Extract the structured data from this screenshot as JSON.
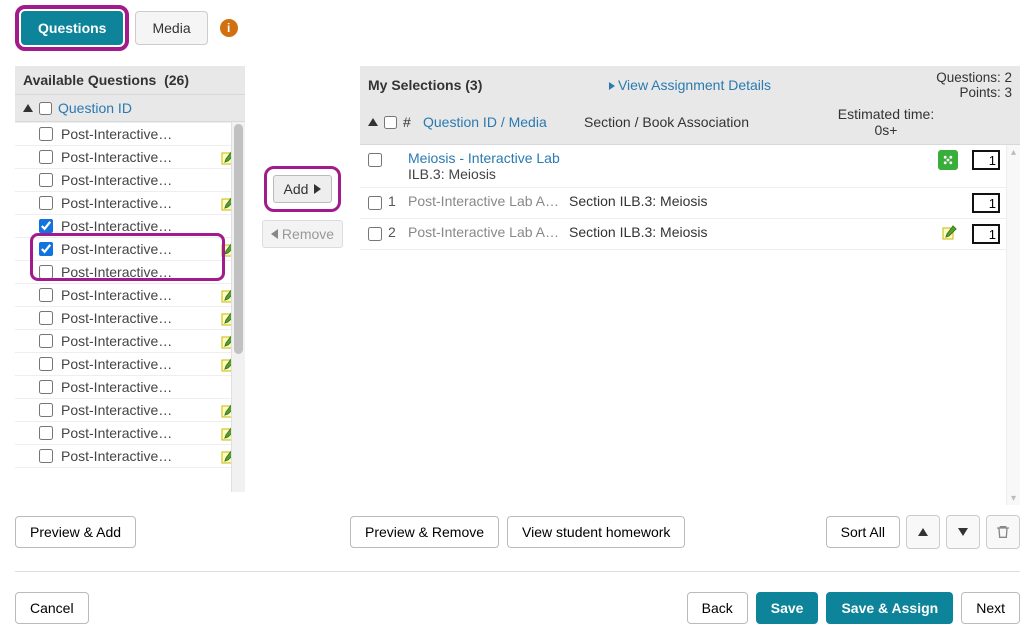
{
  "tabs": {
    "questions": "Questions",
    "media": "Media"
  },
  "left": {
    "title": "Available Questions",
    "count": "(26)",
    "sort_col": "Question ID",
    "items": [
      {
        "label": "Post-Interactive…",
        "checked": false,
        "edit": false
      },
      {
        "label": "Post-Interactive…",
        "checked": false,
        "edit": true
      },
      {
        "label": "Post-Interactive…",
        "checked": false,
        "edit": false
      },
      {
        "label": "Post-Interactive…",
        "checked": false,
        "edit": true
      },
      {
        "label": "Post-Interactive…",
        "checked": true,
        "edit": false
      },
      {
        "label": "Post-Interactive…",
        "checked": true,
        "edit": true
      },
      {
        "label": "Post-Interactive…",
        "checked": false,
        "edit": false
      },
      {
        "label": "Post-Interactive…",
        "checked": false,
        "edit": true
      },
      {
        "label": "Post-Interactive…",
        "checked": false,
        "edit": true
      },
      {
        "label": "Post-Interactive…",
        "checked": false,
        "edit": true
      },
      {
        "label": "Post-Interactive…",
        "checked": false,
        "edit": true
      },
      {
        "label": "Post-Interactive…",
        "checked": false,
        "edit": false
      },
      {
        "label": "Post-Interactive…",
        "checked": false,
        "edit": true
      },
      {
        "label": "Post-Interactive…",
        "checked": false,
        "edit": true
      },
      {
        "label": "Post-Interactive…",
        "checked": false,
        "edit": true
      }
    ]
  },
  "mid": {
    "add": "Add",
    "remove": "Remove"
  },
  "right": {
    "title": "My Selections (3)",
    "view_link": "View Assignment Details",
    "stats_q": "Questions: 2",
    "stats_p": "Points: 3",
    "col_num": "#",
    "col_qid": "Question ID / Media",
    "col_section": "Section / Book Association",
    "col_time_label": "Estimated time:",
    "col_time_val": "0s+",
    "rows": [
      {
        "num": "",
        "q": "Meiosis - Interactive Lab",
        "sub": "ILB.3: Meiosis",
        "section": "",
        "link": true,
        "badge": true,
        "points": "1",
        "edit": false
      },
      {
        "num": "1",
        "q": "Post-Interactive Lab As…",
        "sub": "",
        "section": "Section ILB.3: Meiosis",
        "link": false,
        "badge": false,
        "points": "1",
        "edit": false
      },
      {
        "num": "2",
        "q": "Post-Interactive Lab As…",
        "sub": "",
        "section": "Section ILB.3: Meiosis",
        "link": false,
        "badge": false,
        "points": "1",
        "edit": true
      }
    ]
  },
  "buttons": {
    "preview_add": "Preview & Add",
    "preview_remove": "Preview & Remove",
    "view_student": "View student homework",
    "sort_all": "Sort All",
    "cancel": "Cancel",
    "back": "Back",
    "save": "Save",
    "save_assign": "Save & Assign",
    "next": "Next"
  }
}
